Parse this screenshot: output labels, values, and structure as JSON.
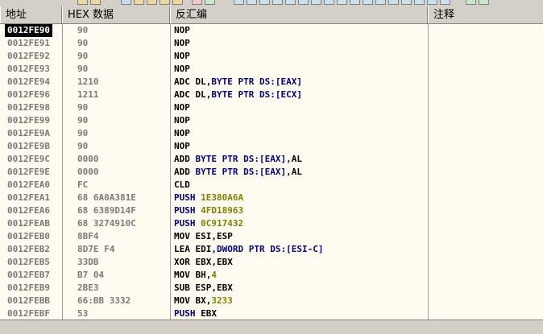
{
  "columns": {
    "address": "地址",
    "hex": "HEX 数据",
    "disassembly": "反汇编",
    "comment": "注释"
  },
  "selected_index": 0,
  "rows": [
    {
      "address": "0012FE90",
      "hex": "90",
      "parts": [
        {
          "t": "NOP",
          "c": "mnem"
        }
      ]
    },
    {
      "address": "0012FE91",
      "hex": "90",
      "parts": [
        {
          "t": "NOP",
          "c": "mnem"
        }
      ]
    },
    {
      "address": "0012FE92",
      "hex": "90",
      "parts": [
        {
          "t": "NOP",
          "c": "mnem"
        }
      ]
    },
    {
      "address": "0012FE93",
      "hex": "90",
      "parts": [
        {
          "t": "NOP",
          "c": "mnem"
        }
      ]
    },
    {
      "address": "0012FE94",
      "hex": "1210",
      "parts": [
        {
          "t": "ADC ",
          "c": "mnem"
        },
        {
          "t": "DL,",
          "c": "oper-dark"
        },
        {
          "t": "BYTE PTR DS:[EAX]",
          "c": "oper-blue"
        }
      ]
    },
    {
      "address": "0012FE96",
      "hex": "1211",
      "parts": [
        {
          "t": "ADC ",
          "c": "mnem"
        },
        {
          "t": "DL,",
          "c": "oper-dark"
        },
        {
          "t": "BYTE PTR DS:[ECX]",
          "c": "oper-blue"
        }
      ]
    },
    {
      "address": "0012FE98",
      "hex": "90",
      "parts": [
        {
          "t": "NOP",
          "c": "mnem"
        }
      ]
    },
    {
      "address": "0012FE99",
      "hex": "90",
      "parts": [
        {
          "t": "NOP",
          "c": "mnem"
        }
      ]
    },
    {
      "address": "0012FE9A",
      "hex": "90",
      "parts": [
        {
          "t": "NOP",
          "c": "mnem"
        }
      ]
    },
    {
      "address": "0012FE9B",
      "hex": "90",
      "parts": [
        {
          "t": "NOP",
          "c": "mnem"
        }
      ]
    },
    {
      "address": "0012FE9C",
      "hex": "0000",
      "parts": [
        {
          "t": "ADD ",
          "c": "mnem"
        },
        {
          "t": "BYTE PTR DS:[EAX]",
          "c": "oper-blue"
        },
        {
          "t": ",AL",
          "c": "oper-dark"
        }
      ]
    },
    {
      "address": "0012FE9E",
      "hex": "0000",
      "parts": [
        {
          "t": "ADD ",
          "c": "mnem"
        },
        {
          "t": "BYTE PTR DS:[EAX]",
          "c": "oper-blue"
        },
        {
          "t": ",AL",
          "c": "oper-dark"
        }
      ]
    },
    {
      "address": "0012FEA0",
      "hex": "FC",
      "parts": [
        {
          "t": "CLD",
          "c": "mnem"
        }
      ]
    },
    {
      "address": "0012FEA1",
      "hex": "68 6A0A381E",
      "parts": [
        {
          "t": "PUSH ",
          "c": "mnem push"
        },
        {
          "t": "1E380A6A",
          "c": "num"
        }
      ]
    },
    {
      "address": "0012FEA6",
      "hex": "68 6389D14F",
      "parts": [
        {
          "t": "PUSH ",
          "c": "mnem push"
        },
        {
          "t": "4FD18963",
          "c": "num"
        }
      ]
    },
    {
      "address": "0012FEAB",
      "hex": "68 3274910C",
      "parts": [
        {
          "t": "PUSH ",
          "c": "mnem push"
        },
        {
          "t": "0C917432",
          "c": "num"
        }
      ]
    },
    {
      "address": "0012FEB0",
      "hex": "8BF4",
      "parts": [
        {
          "t": "MOV ",
          "c": "mnem"
        },
        {
          "t": "ESI,ESP",
          "c": "oper-dark"
        }
      ]
    },
    {
      "address": "0012FEB2",
      "hex": "8D7E F4",
      "parts": [
        {
          "t": "LEA ",
          "c": "mnem"
        },
        {
          "t": "EDI,",
          "c": "oper-dark"
        },
        {
          "t": "DWORD PTR DS:[ESI-C]",
          "c": "oper-blue"
        }
      ]
    },
    {
      "address": "0012FEB5",
      "hex": "33DB",
      "parts": [
        {
          "t": "XOR ",
          "c": "mnem"
        },
        {
          "t": "EBX,EBX",
          "c": "oper-dark"
        }
      ]
    },
    {
      "address": "0012FEB7",
      "hex": "B7 04",
      "parts": [
        {
          "t": "MOV ",
          "c": "mnem"
        },
        {
          "t": "BH,",
          "c": "oper-dark"
        },
        {
          "t": "4",
          "c": "num"
        }
      ]
    },
    {
      "address": "0012FEB9",
      "hex": "2BE3",
      "parts": [
        {
          "t": "SUB ",
          "c": "mnem"
        },
        {
          "t": "ESP,EBX",
          "c": "oper-dark"
        }
      ]
    },
    {
      "address": "0012FEBB",
      "hex": "66:BB 3332",
      "parts": [
        {
          "t": "MOV ",
          "c": "mnem"
        },
        {
          "t": "BX,",
          "c": "oper-dark"
        },
        {
          "t": "3233",
          "c": "num"
        }
      ]
    },
    {
      "address": "0012FEBF",
      "hex": "53",
      "parts": [
        {
          "t": "PUSH ",
          "c": "mnem push"
        },
        {
          "t": "EBX",
          "c": "oper-dark"
        }
      ]
    }
  ]
}
